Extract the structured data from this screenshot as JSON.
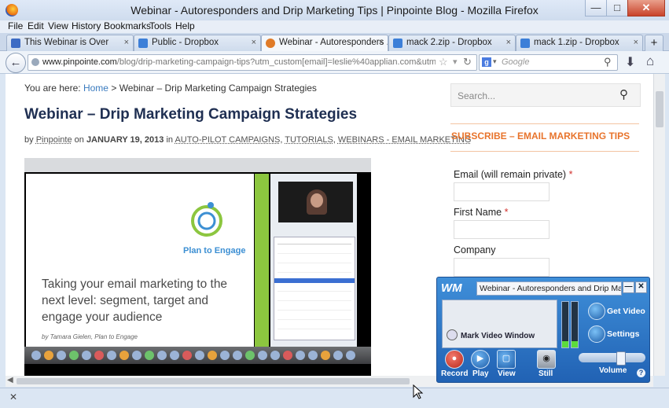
{
  "window": {
    "title": "Webinar - Autoresponders and Drip Marketing Tips | Pinpointe Blog - Mozilla Firefox",
    "controls": [
      "—",
      "□",
      "✕"
    ]
  },
  "menu": [
    "File",
    "Edit",
    "View",
    "History",
    "Bookmarks",
    "Tools",
    "Help"
  ],
  "tabs": [
    {
      "label": "This Webinar is Over",
      "active": false
    },
    {
      "label": "Public - Dropbox",
      "active": false
    },
    {
      "label": "Webinar - Autoresponders ...",
      "active": true
    },
    {
      "label": "mack 2.zip - Dropbox",
      "active": false
    },
    {
      "label": "mack 1.zip - Dropbox",
      "active": false
    }
  ],
  "tab_close": "×",
  "new_tab": "+",
  "nav": {
    "url_domain": "www.pinpointe.com",
    "url_path": "/blog/drip-marketing-campaign-tips?utm_custom[email]=leslie%40applian.com&utm_custon",
    "search_placeholder": "Google"
  },
  "page": {
    "breadcrumb_prefix": "You are here:",
    "breadcrumb_home": "Home",
    "breadcrumb_sep": ">",
    "breadcrumb_current": "Webinar – Drip Marketing Campaign Strategies",
    "title": "Webinar – Drip Marketing Campaign Strategies",
    "byline": {
      "by": "by",
      "author": "Pinpointe",
      "on": "on",
      "date": "JANUARY 19, 2013",
      "in": "in",
      "categories": [
        "AUTO-PILOT CAMPAIGNS",
        "TUTORIALS",
        "WEBINARS - EMAIL MARKETING"
      ]
    },
    "video": {
      "logo_text": "Plan to Engage",
      "slide_text": "Taking your email marketing to the next level: segment, target and engage your audience",
      "slide_author": "by Tamara Gielen, Plan to Engage"
    }
  },
  "sidebar": {
    "search_placeholder": "Search...",
    "subscribe_heading": "SUBSCRIBE – EMAIL MARKETING TIPS",
    "fields": [
      {
        "label": "Email (will remain private)",
        "required": true
      },
      {
        "label": "First Name",
        "required": true
      },
      {
        "label": "Company",
        "required": false
      }
    ],
    "required_mark": "*"
  },
  "wm_widget": {
    "logo": "WM",
    "title": "Webinar - Autoresponders and Drip Marketin",
    "minimize": "—",
    "close": "✕",
    "mark_video": "Mark Video Window",
    "buttons": [
      "Record",
      "Play",
      "View",
      "Still"
    ],
    "get_video": "Get Video",
    "settings": "Settings",
    "volume": "Volume",
    "help": "?"
  },
  "status": {
    "close": "✕"
  },
  "colors": {
    "link": "#3a7bbf",
    "heading": "#1f2f52",
    "accent": "#e8742c",
    "widget": "#2162b4"
  }
}
